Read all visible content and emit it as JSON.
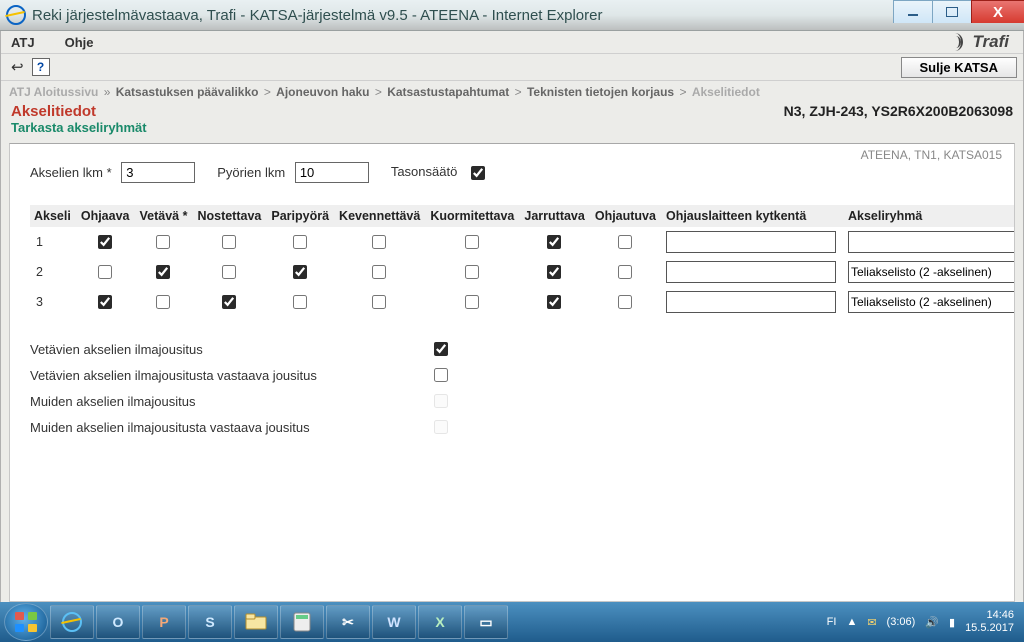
{
  "window": {
    "title": "Reki järjestelmävastaava, Trafi - KATSA-järjestelmä v9.5 - ATEENA - Internet Explorer"
  },
  "menu": {
    "item1": "ATJ",
    "item2": "Ohje",
    "brand": "Trafi"
  },
  "toolbar": {
    "close_label": "Sulje KATSA"
  },
  "breadcrumb": {
    "b0": "ATJ Aloitussivu",
    "b1": "Katsastuksen päävalikko",
    "b2": "Ajoneuvon haku",
    "b3": "Katsastustapahtumat",
    "b4": "Teknisten tietojen korjaus",
    "b5": "Akselitiedot"
  },
  "page": {
    "title": "Akselitiedot",
    "subtitle": "Tarkasta akseliryhmät",
    "vehicle": "N3, ZJH-243, YS2R6X200B2063098",
    "corner": "ATEENA, TN1, KATSA015"
  },
  "top": {
    "akselien_label": "Akselien lkm",
    "akselien_value": "3",
    "pyorien_label": "Pyörien lkm",
    "pyorien_value": "10",
    "tasonsaato_label": "Tasonsäätö",
    "tasonsaato_checked": true
  },
  "columns": {
    "c0": "Akseli",
    "c1": "Ohjaava",
    "c2": "Vetävä *",
    "c3": "Nostettava",
    "c4": "Paripyörä",
    "c5": "Kevennettävä",
    "c6": "Kuormitettava",
    "c7": "Jarruttava",
    "c8": "Ohjautuva",
    "c9": "Ohjauslaitteen kytkentä",
    "c10": "Akseliryhmä"
  },
  "rows": [
    {
      "n": "1",
      "ohjaava": true,
      "vetava": false,
      "nostettava": false,
      "paripyora": false,
      "kevennettava": false,
      "kuormitettava": false,
      "jarruttava": true,
      "ohjautuva": false,
      "ohjaus": "",
      "ryhma": ""
    },
    {
      "n": "2",
      "ohjaava": false,
      "vetava": true,
      "nostettava": false,
      "paripyora": true,
      "kevennettava": false,
      "kuormitettava": false,
      "jarruttava": true,
      "ohjautuva": false,
      "ohjaus": "",
      "ryhma": "Teliakselisto (2 -akselinen)"
    },
    {
      "n": "3",
      "ohjaava": true,
      "vetava": false,
      "nostettava": true,
      "paripyora": false,
      "kevennettava": false,
      "kuormitettava": false,
      "jarruttava": true,
      "ohjautuva": false,
      "ohjaus": "",
      "ryhma": "Teliakselisto (2 -akselinen)"
    }
  ],
  "susp": {
    "s1": {
      "label": "Vetävien akselien ilmajousitus",
      "checked": true,
      "enabled": true
    },
    "s2": {
      "label": "Vetävien akselien ilmajousitusta vastaava jousitus",
      "checked": false,
      "enabled": true
    },
    "s3": {
      "label": "Muiden akselien ilmajousitus",
      "checked": false,
      "enabled": false
    },
    "s4": {
      "label": "Muiden akselien ilmajousitusta vastaava jousitus",
      "checked": false,
      "enabled": false
    }
  },
  "taskbar": {
    "lang": "FI",
    "battery": "(3:06)",
    "time": "14:46",
    "date": "15.5.2017"
  }
}
